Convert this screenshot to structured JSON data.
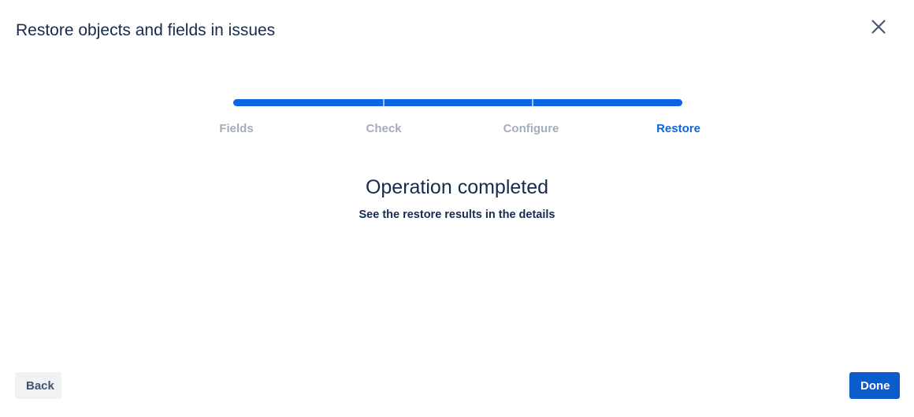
{
  "dialog": {
    "title": "Restore objects and fields in issues",
    "close_icon": "close-icon"
  },
  "wizard": {
    "progress_fraction": 1.0,
    "accent_color": "#0c66e4",
    "inactive_color": "#a5adba",
    "steps": [
      {
        "label": "Fields",
        "active": false
      },
      {
        "label": "Check",
        "active": false
      },
      {
        "label": "Configure",
        "active": false
      },
      {
        "label": "Restore",
        "active": true
      }
    ]
  },
  "result": {
    "title": "Operation completed",
    "subtitle": "See the restore results in the details"
  },
  "footer": {
    "back_label": "Back",
    "done_label": "Done",
    "done_color": "#0c5ccb"
  }
}
